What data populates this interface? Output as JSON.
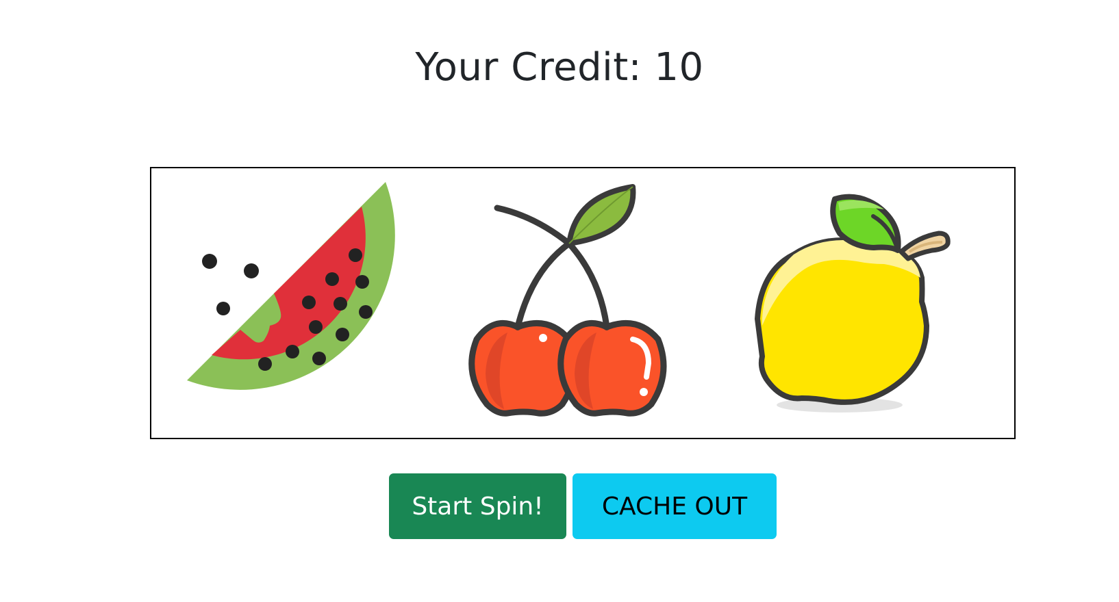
{
  "credit": {
    "text": "Your Credit: 10"
  },
  "reels": [
    {
      "symbol": "watermelon",
      "icon": "watermelon-icon"
    },
    {
      "symbol": "cherry",
      "icon": "cherry-icon"
    },
    {
      "symbol": "lemon",
      "icon": "lemon-icon"
    }
  ],
  "buttons": {
    "spin_label": "Start Spin!",
    "cash_label": "CACHE OUT"
  },
  "colors": {
    "spin_button": "#198754",
    "cash_button": "#0dcaf0",
    "watermelon_rind": "#8bc057",
    "watermelon_flesh": "#e0303a",
    "cherry_red": "#fa5329",
    "lemon_yellow": "#ffe500",
    "leaf_green": "#6dd627"
  }
}
